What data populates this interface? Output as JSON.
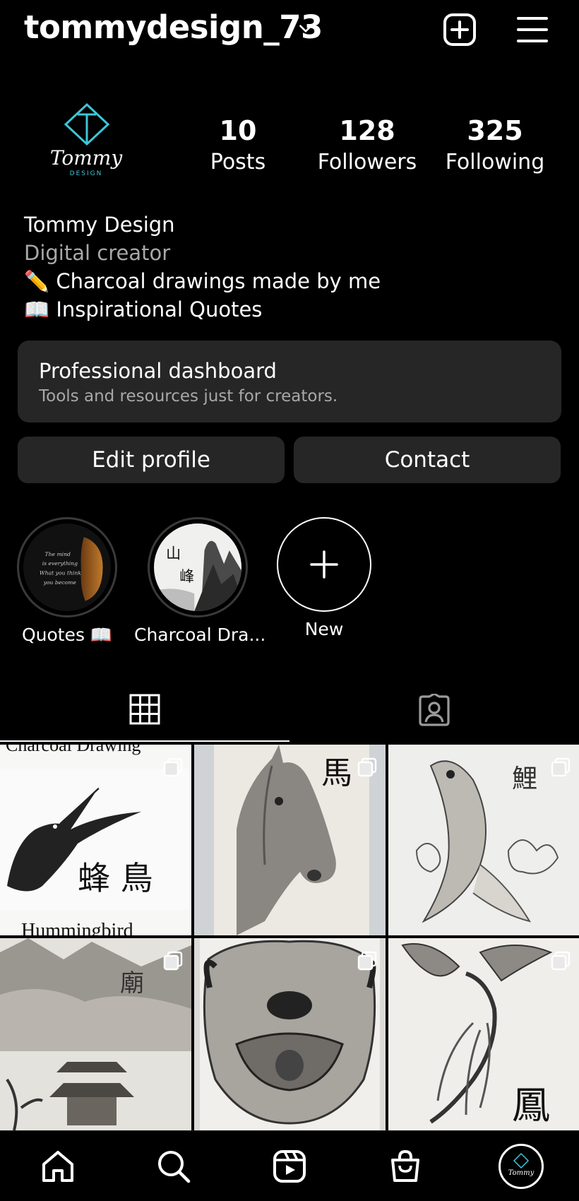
{
  "header": {
    "username": "tommydesign_73"
  },
  "profile": {
    "avatar_logo_text": "Tommy",
    "avatar_logo_subtext": "DESIGN",
    "stats": [
      {
        "value": "10",
        "label": "Posts"
      },
      {
        "value": "128",
        "label": "Followers"
      },
      {
        "value": "325",
        "label": "Following"
      }
    ],
    "bio": {
      "name": "Tommy Design",
      "category": "Digital creator",
      "line1": "✏️ Charcoal drawings made by me",
      "line2": "📖 Inspirational Quotes"
    }
  },
  "dashboard": {
    "title": "Professional dashboard",
    "subtitle": "Tools and resources just for creators."
  },
  "actions": {
    "edit_label": "Edit profile",
    "contact_label": "Contact"
  },
  "highlights": [
    {
      "label": "Quotes 📖",
      "cover_text": [
        "The mind",
        "is everything",
        "What you think",
        "you become"
      ]
    },
    {
      "label": "Charcoal Dra...",
      "cover_kanji": [
        "山",
        "峰"
      ]
    },
    {
      "label": "New"
    }
  ],
  "tabs": [
    "grid-icon",
    "tagged-icon"
  ],
  "grid": {
    "posts": [
      {
        "caption_top": "Charcoal Drawing",
        "caption_bottom": "Hummingbird",
        "kanji": "蜂 鳥"
      },
      {
        "kanji": "馬"
      },
      {
        "kanji": "鯉"
      },
      {
        "kanji": "廟"
      },
      {},
      {
        "kanji": "鳳"
      }
    ]
  },
  "bottom_nav": [
    "home-icon",
    "search-icon",
    "reels-icon",
    "shop-icon",
    "profile-avatar"
  ],
  "colors": {
    "background": "#000000",
    "surface": "#262626",
    "secondary_text": "#a8a8a8",
    "logo_accent": "#3ec6d8"
  }
}
